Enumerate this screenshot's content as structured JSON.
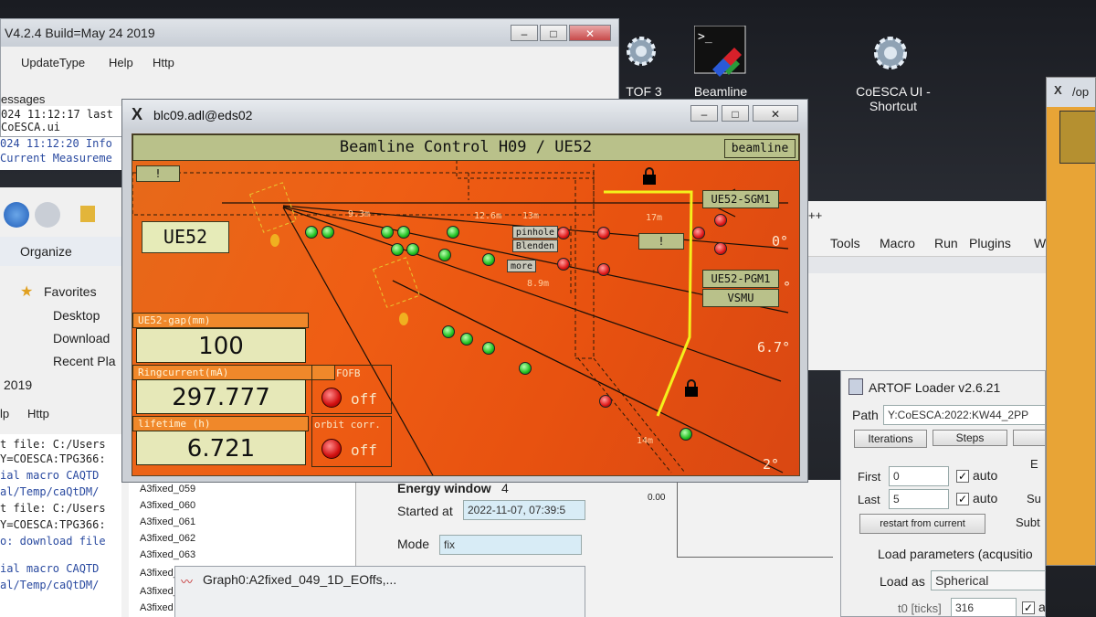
{
  "desktop": {
    "icons": [
      {
        "label": "TOF 3",
        "icon": "gear-icon"
      },
      {
        "label": "Beamline",
        "icon": "terminal-icon"
      },
      {
        "label": "CoESCA UI - Shortcut",
        "icon": "gear-icon"
      }
    ]
  },
  "back_window": {
    "title": "V4.2.4 Build=May 24 2019",
    "menu": [
      "UpdateType",
      "Help",
      "Http"
    ],
    "messages_label": "essages",
    "log": [
      "024 11:12:17 last",
      " CoESCA.ui",
      "024 11:12:20 Info",
      "Current Measureme"
    ]
  },
  "explorer": {
    "organize": "Organize",
    "nav": [
      "Favorites",
      "Desktop",
      "Download",
      "Recent Pla"
    ]
  },
  "lower_left": {
    "year": "2019",
    "menu": [
      "lp",
      "Http"
    ],
    "log": [
      "t file: C:/Users",
      "Y=COESCA:TPG366:",
      "ial macro CAQTD",
      "al/Temp/caQtDM/",
      "t file: C:/Users",
      "Y=COESCA:TPG366:",
      "o: download file",
      "ial macro CAQTD",
      "al/Temp/caQtDM/"
    ]
  },
  "beamline_window": {
    "title": "blc09.adl@eds02",
    "header": "Beamline Control H09 / UE52",
    "beamline_btn": "beamline",
    "bang_btn": "!",
    "source_btn": "UE52",
    "sgm_btn": "UE52-SGM1",
    "pgm_btn": "UE52-PGM1",
    "vsmu_btn": "VSMU",
    "mid_bang": "!",
    "pinhole": "pinhole",
    "blenden": "Blenden",
    "more": "more",
    "distances": [
      "9.3m",
      "12.6m",
      "13m",
      "17m",
      "8.9m",
      "14m"
    ],
    "angles": [
      "0°",
      "°",
      "6.7°",
      "2°"
    ],
    "gap_label": "UE52-gap(mm)",
    "gap_value": "100",
    "ring_label": "Ringcurrent(mA)",
    "ring_value": "297.777",
    "life_label": "lifetime (h)",
    "life_value": "6.721",
    "fofb_label": "FOFB",
    "fofb_state": "off",
    "orbit_label": "orbit corr.",
    "orbit_state": "off"
  },
  "center_bottom": {
    "list": [
      "A3fixed_059",
      "A3fixed_060",
      "A3fixed_061",
      "A3fixed_062",
      "A3fixed_063",
      "A3fixed_",
      "A3fixed_",
      "A3fixed"
    ],
    "energy_label": "Energy window",
    "energy_value": "4",
    "started_label": "Started at",
    "started_value": "2022-11-07, 07:39:5",
    "mode_label": "Mode",
    "mode_value": "fix",
    "axis_value": "0.00",
    "graph_title": "Graph0:A2fixed_049_1D_EOffs,..."
  },
  "right_menu": [
    "++",
    "Tools",
    "Macro",
    "Run",
    "Plugins",
    "W"
  ],
  "artof": {
    "title": "ARTOF Loader v2.6.21",
    "path_label": "Path",
    "path_value": "Y:CoESCA:2022:KW44_2PP",
    "tabs": [
      "Iterations",
      "Steps"
    ],
    "first_label": "First",
    "first_value": "0",
    "last_label": "Last",
    "last_value": "5",
    "auto": "auto",
    "restart": "restart from current",
    "load_params": "Load parameters (acqusitio",
    "load_as_label": "Load as",
    "load_as_value": "Spherical",
    "t0_label": "t0 [ticks]",
    "t0_value": "316",
    "side": [
      "E",
      "Su",
      "Subt"
    ]
  },
  "far_right": {
    "title": "/op"
  }
}
